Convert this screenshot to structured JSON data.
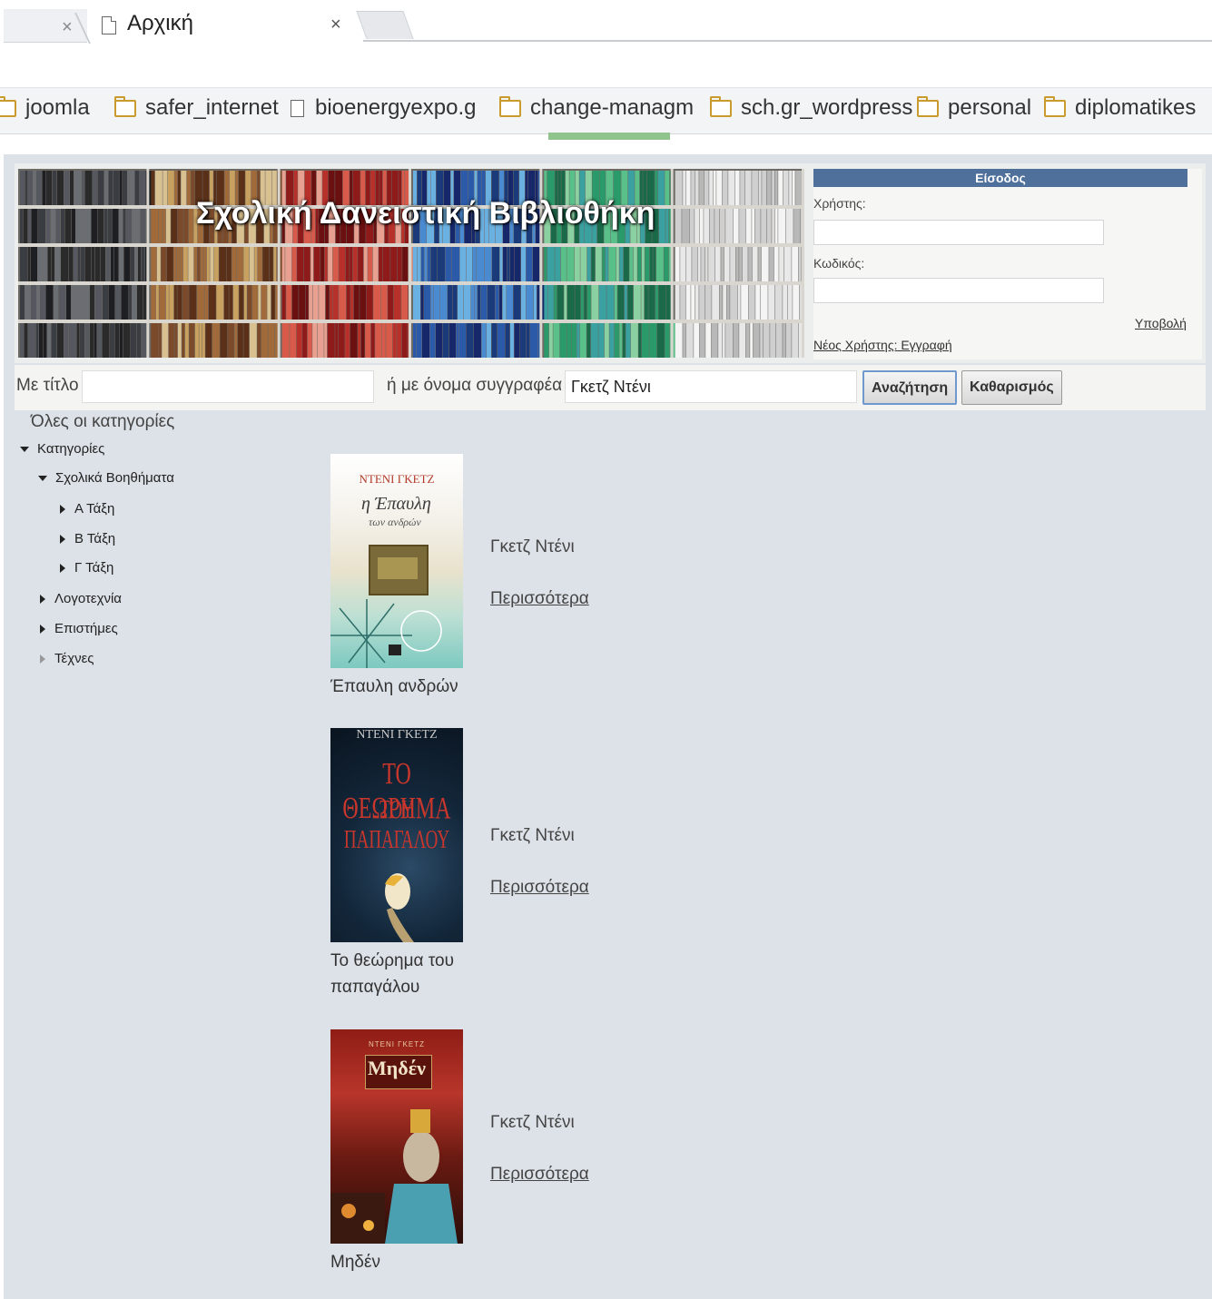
{
  "browser": {
    "active_tab_title": "Αρχική",
    "close_glyph": "×",
    "bookmarks": [
      {
        "label": "joomla",
        "icon": "folder-icon"
      },
      {
        "label": "safer_internet",
        "icon": "folder-icon"
      },
      {
        "label": "bioenergyexpo.g",
        "icon": "page-icon"
      },
      {
        "label": "change-managm",
        "icon": "folder-icon"
      },
      {
        "label": "sch.gr_wordpress",
        "icon": "folder-icon"
      },
      {
        "label": "personal",
        "icon": "folder-icon"
      },
      {
        "label": "diplomatikes",
        "icon": "folder-icon"
      }
    ]
  },
  "header": {
    "site_title": "Σχολική Δανειστική Βιβλιοθήκη"
  },
  "login": {
    "heading": "Είσοδος",
    "username_label": "Χρήστης:",
    "password_label": "Κωδικός:",
    "submit_label": "Υποβολή",
    "register_label": "Νέος Χρήστης: Εγγραφή"
  },
  "search": {
    "title_label": "Με τίτλο",
    "title_value": "",
    "author_label": "ή με όνομα συγγραφέα",
    "author_value": "Γκετζ Ντένι",
    "search_button": "Αναζήτηση",
    "clear_button": "Καθαρισμός"
  },
  "categories": {
    "all_label": "Όλες οι κατηγορίες",
    "root": "Κατηγορίες",
    "school_aids": "Σχολικά Βοηθήματα",
    "grade_a": "Α Τάξη",
    "grade_b": "Β Τάξη",
    "grade_c": "Γ Τάξη",
    "literature": "Λογοτεχνία",
    "sciences": "Επιστήμες",
    "arts": "Τέχνες"
  },
  "books": [
    {
      "title": "Έπαυλη ανδρών",
      "author": "Γκετζ Ντένι",
      "more": "Περισσότερα",
      "cover_author": "ΝΤΕΝΙ ΓΚΕΤΖ",
      "cover_title_1": "η Έπαυλη",
      "cover_title_2": "των ανδρών"
    },
    {
      "title": "Το θεώρημα του παπαγάλου",
      "author": "Γκετζ Ντένι",
      "more": "Περισσότερα",
      "cover_author": "ΝΤΕΝΙ ΓΚΕΤΖ",
      "cover_title_1": "ΤΟ ΘΕΩΡΗΜΑ",
      "cover_title_2": "ΤΟΥ ΠΑΠΑΓΑΛΟΥ"
    },
    {
      "title": "Μηδέν",
      "author": "Γκετζ Ντένι",
      "more": "Περισσότερα",
      "cover_author": "ΝΤΕΝΙ ΓΚΕΤΖ",
      "cover_title_1": "Μηδέν",
      "cover_title_2": ""
    }
  ],
  "colors": {
    "login_header": "#50709c",
    "page_background": "#dde2e8",
    "button_focus": "#6f98cc"
  }
}
